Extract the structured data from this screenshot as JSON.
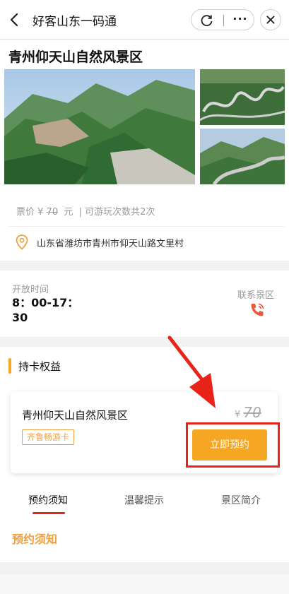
{
  "nav": {
    "title": "好客山东一码通",
    "more_label": "···"
  },
  "scenic": {
    "name": "青州仰天山自然风景区",
    "price_prefix": "票价 ¥",
    "price_value": "70",
    "price_unit": "元",
    "visits_note": "| 可游玩次数共2次",
    "address": "山东省潍坊市青州市仰天山路文里村"
  },
  "hours": {
    "label": "开放时间",
    "value": "8：00-17：30",
    "contact_label": "联系景区"
  },
  "benefits": {
    "section_title": "持卡权益",
    "card_name": "青州仰天山自然风景区",
    "card_tag": "齐鲁畅游卡",
    "currency": "¥",
    "card_price": "70",
    "book_label": "立即预约"
  },
  "tabs": [
    {
      "label": "预约须知"
    },
    {
      "label": "温馨提示"
    },
    {
      "label": "景区简介"
    }
  ],
  "notice": {
    "title": "预约须知"
  },
  "colors": {
    "accent_orange": "#f5a623",
    "annotation_red": "#e8231a"
  },
  "icons": [
    "back-icon",
    "refresh-icon",
    "more-icon",
    "close-icon",
    "location-pin-icon",
    "phone-icon"
  ]
}
